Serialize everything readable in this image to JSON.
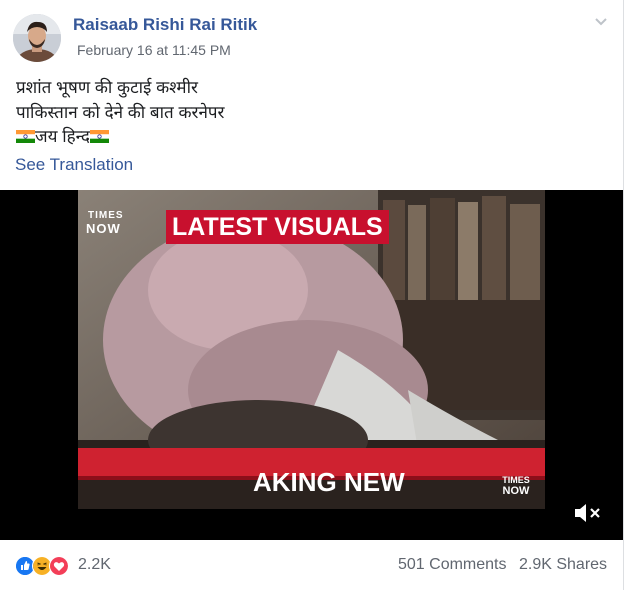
{
  "post": {
    "author": "Raisaab Rishi Rai Ritik",
    "timestamp": "February 16 at 11:45 PM",
    "text_line1": "प्रशांत भूषण की कुटाई कश्मीर",
    "text_line2": "पाकिस्तान को देने की बात करनेपर",
    "text_line3": "जय हिन्द",
    "see_translation": "See Translation"
  },
  "video": {
    "channel_top": "TIMES",
    "channel_bottom": "NOW",
    "headline": "LATEST VISUALS",
    "ticker": "AKING NEW",
    "corner_top": "TIMES",
    "corner_bottom": "NOW",
    "mute_icon": "speaker-muted-icon"
  },
  "engagement": {
    "reactions_count": "2.2K",
    "comments": "501 Comments",
    "shares": "2.9K Shares",
    "reaction_icons": [
      "like-icon",
      "haha-icon",
      "love-icon"
    ]
  },
  "colors": {
    "link": "#365899",
    "meta": "#616770",
    "times_red": "#c8102e",
    "like_blue": "#1877f2",
    "haha_yellow": "#f7b125",
    "love_red": "#f33e58"
  }
}
